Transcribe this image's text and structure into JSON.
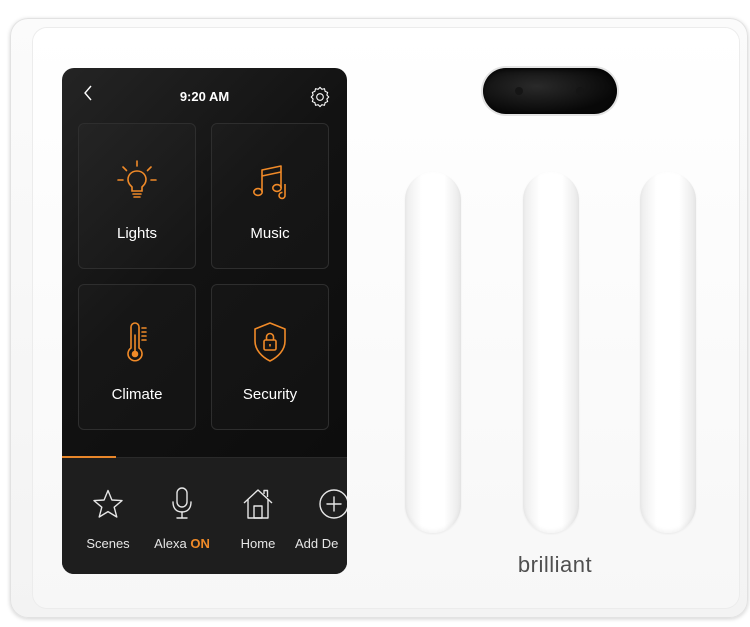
{
  "device": {
    "brand_logo": "brilliant",
    "slot_count": 3
  },
  "screen": {
    "time": "9:20 AM",
    "back_icon": "chevron-left-icon",
    "settings_icon": "gear-icon",
    "tiles": [
      {
        "label": "Lights",
        "icon": "lightbulb-icon"
      },
      {
        "label": "Music",
        "icon": "music-notes-icon"
      },
      {
        "label": "Climate",
        "icon": "thermometer-icon"
      },
      {
        "label": "Security",
        "icon": "shield-lock-icon"
      }
    ],
    "nav": {
      "scenes": {
        "label": "Scenes",
        "icon": "star-icon"
      },
      "alexa": {
        "label": "Alexa",
        "status": "ON",
        "icon": "microphone-icon"
      },
      "home": {
        "label": "Home",
        "icon": "house-icon"
      },
      "add": {
        "label": "Add De",
        "icon": "plus-circle-icon"
      }
    },
    "page_progress": 0.19
  },
  "colors": {
    "accent": "#f08a28",
    "screen_bg": "#0b0b0b",
    "plate": "#f7f7f7"
  }
}
